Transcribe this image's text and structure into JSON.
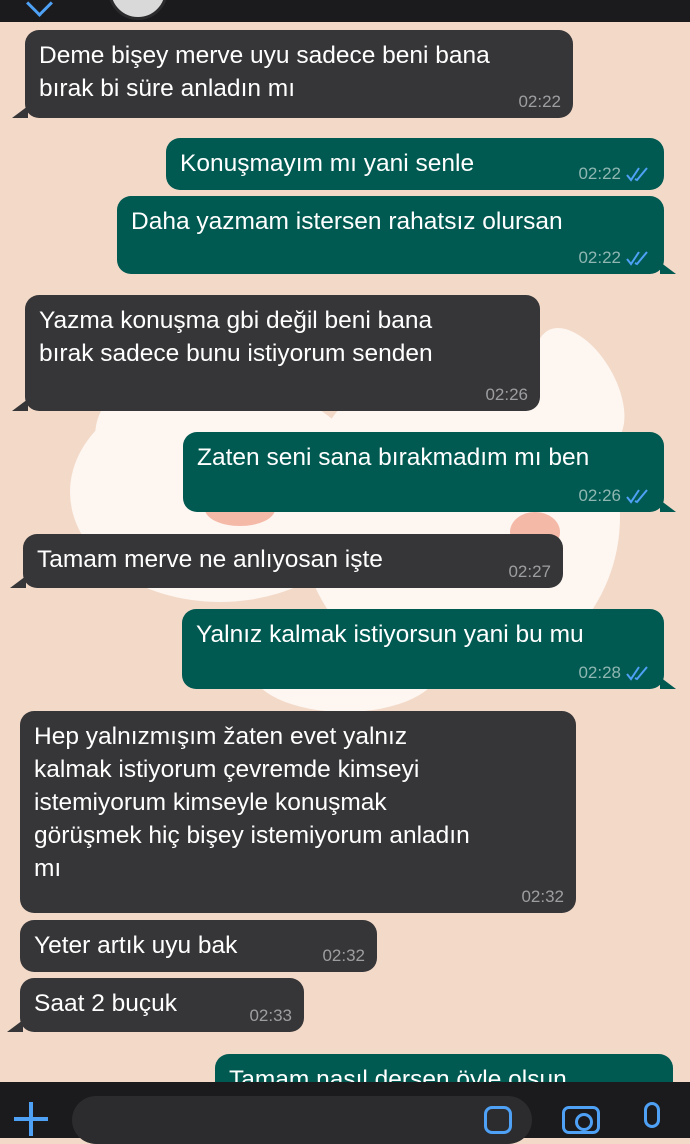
{
  "messages": [
    {
      "direction": "in",
      "text": "Deme bişey merve uyu sadece beni bana\nbırak bi süre anladın mı",
      "time": "02:22"
    },
    {
      "direction": "out",
      "text": "Konuşmayım mı yani senle",
      "time": "02:22"
    },
    {
      "direction": "out",
      "text": "Daha yazmam istersen rahatsız olursan",
      "time": "02:22"
    },
    {
      "direction": "in",
      "text": "Yazma konuşma gbi değil beni bana\nbırak sadece bunu istiyorum senden",
      "time": "02:26"
    },
    {
      "direction": "out",
      "text": "Zaten seni sana bırakmadım mı ben",
      "time": "02:26"
    },
    {
      "direction": "in",
      "text": "Tamam merve ne anlıyosan işte",
      "time": "02:27"
    },
    {
      "direction": "out",
      "text": "Yalnız kalmak istiyorsun yani bu mu",
      "time": "02:28"
    },
    {
      "direction": "in",
      "text": "Hep yalnızmışım žaten evet yalnız\nkalmak istiyorum çevremde kimseyi\nistemiyorum kimseyle konuşmak\ngörüşmek hiç bişey istemiyorum anladın\nmı",
      "time": "02:32"
    },
    {
      "direction": "in",
      "text": "Yeter artık uyu bak",
      "time": "02:32"
    },
    {
      "direction": "in",
      "text": "Saat 2 buçuk",
      "time": "02:33"
    },
    {
      "direction": "out",
      "text": "Tamam nasıl dersen öyle olsun",
      "time": ""
    }
  ],
  "icons": {
    "back": "chevron-left-icon",
    "attach": "plus-icon",
    "sticker": "sticker-icon",
    "camera": "camera-icon",
    "mic": "microphone-icon",
    "read": "double-check-icon"
  },
  "colors": {
    "wallpaper": "#f3d9c8",
    "incoming_bubble": "#363638",
    "outgoing_bubble": "#005a52",
    "accent": "#4ea1f5"
  }
}
